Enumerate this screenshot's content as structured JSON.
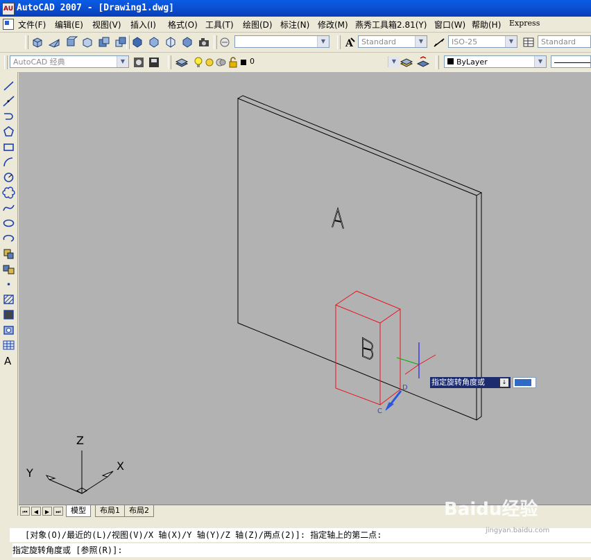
{
  "window": {
    "title": "AutoCAD 2007 - [Drawing1.dwg]",
    "app_icon_text": "AU"
  },
  "menu": [
    "文件(F)",
    "编辑(E)",
    "视图(V)",
    "插入(I)",
    "格式(O)",
    "工具(T)",
    "绘图(D)",
    "标注(N)",
    "修改(M)",
    "燕秀工具箱2.81(Y)",
    "窗口(W)",
    "帮助(H)",
    "Express"
  ],
  "toolbar1": {
    "text_style": "Standard",
    "dim_style": "ISO-25",
    "table_style": "Standard"
  },
  "toolbar2": {
    "workspace": "AutoCAD 经典",
    "layer": "0",
    "color": "ByLayer"
  },
  "drawing": {
    "label_a": "A",
    "label_b": "B",
    "label_c": "C",
    "label_d": "D",
    "ucs": {
      "x": "X",
      "y": "Y",
      "z": "Z"
    },
    "colors": {
      "box_edge": "#e8141e",
      "panel_edge": "#000000",
      "background": "#b2b2b2",
      "ucs_x": "#ff0000",
      "ucs_y": "#00aa00",
      "ucs_z": "#0000ff"
    }
  },
  "tooltip": {
    "prompt": "指定旋转角度或",
    "icon": "↓"
  },
  "tabs": {
    "model": "模型",
    "layout1": "布局1",
    "layout2": "布局2"
  },
  "command": {
    "line1": "[对象(O)/最近的(L)/视图(V)/X 轴(X)/Y 轴(Y)/Z 轴(Z)/两点(2)]: 指定轴上的第二点:",
    "line2": "指定旋转角度或 [参照(R)]:"
  },
  "watermark": {
    "text": "Baidu经验",
    "url": "jingyan.baidu.com"
  }
}
